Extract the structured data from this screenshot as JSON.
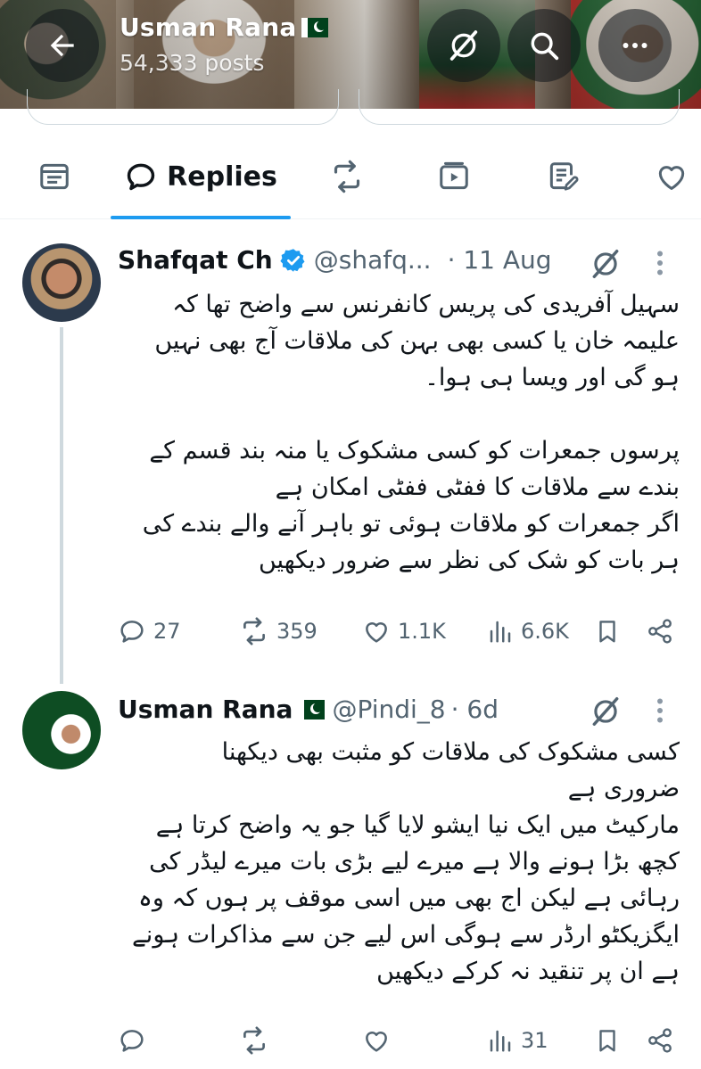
{
  "header": {
    "name": "Usman Rana",
    "posts": "54,333 posts"
  },
  "tabs": {
    "active_label": "Replies"
  },
  "tweets": [
    {
      "name": "Shafqat Ch",
      "handle": "@shafq...",
      "time": "· 11 Aug",
      "body": [
        "سہیل آفریدی کی پریس کانفرنس سے واضح تھا کہ",
        "علیمہ خان یا کسی بھی بہن کی ملاقات آج بھی نہیں",
        "ہو گی اور ویسا ہی ہوا۔",
        "",
        "پرسوں جمعرات کو کسی مشکوک یا منہ بند قسم کے",
        "بندے سے ملاقات کا ففٹی ففٹی امکان ہے",
        "اگر جمعرات کو ملاقات ہوئی تو باہر آنے والے بندے کی",
        "ہر بات کو شک کی نظر سے ضرور دیکھیں"
      ],
      "replies": "27",
      "reposts": "359",
      "likes": "1.1K",
      "views": "6.6K"
    },
    {
      "name": "Usman Rana",
      "handle": "@Pindi_8",
      "time": "· 6d",
      "body": [
        "کسی مشکوک کی ملاقات کو مثبت بھی دیکھنا",
        "ضروری ہے",
        "مارکیٹ میں ایک نیا ایشو لایا گیا جو یہ واضح کرتا ہے",
        "کچھ بڑا ہونے والا ہے میرے لیے بڑی بات میرے لیڈر کی",
        "رہائی ہے لیکن اج بھی میں اسی موقف پر ہوں کہ وہ",
        "ایگزیکٹو ارڈر سے ہوگی اس لیے جن سے مذاکرات ہونے",
        "ہے ان پر تنقید نہ کرکے دیکھیں"
      ],
      "replies": "",
      "reposts": "",
      "likes": "",
      "views": "31"
    }
  ],
  "colors": {
    "accent": "#1d9bf0",
    "text": "#0f1419",
    "muted": "#536471",
    "verified": "#1d9bf0"
  },
  "icons": [
    "back-arrow-icon",
    "grok-icon",
    "search-icon",
    "more-horizontal-icon",
    "posts-icon",
    "reply-icon",
    "repost-icon",
    "video-icon",
    "article-icon",
    "like-icon",
    "verified-icon",
    "more-vertical-icon",
    "views-icon",
    "bookmark-icon",
    "share-icon",
    "pakistan-flag-icon"
  ]
}
